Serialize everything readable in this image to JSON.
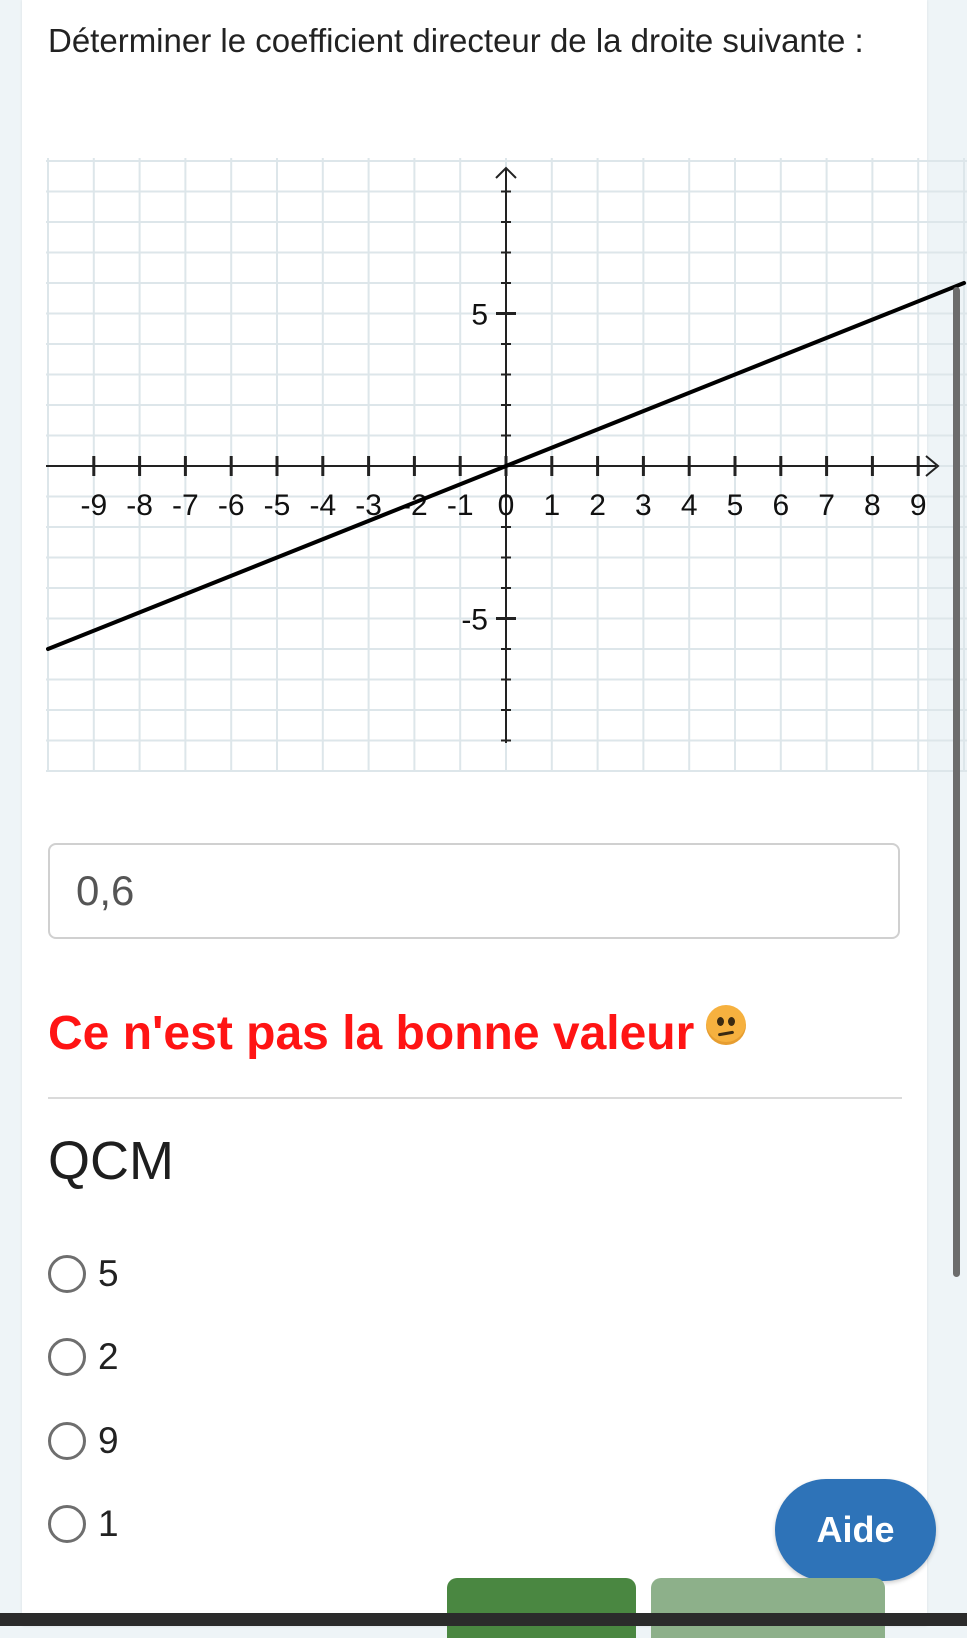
{
  "question": {
    "text": "Déterminer le coefficient directeur de la droite suivante :"
  },
  "chart_data": {
    "type": "line",
    "title": "",
    "xlabel": "",
    "ylabel": "",
    "xlim": [
      -10,
      10
    ],
    "ylim": [
      -10,
      10
    ],
    "grid": true,
    "x_ticks": [
      -9,
      -8,
      -7,
      -6,
      -5,
      -4,
      -3,
      -2,
      -1,
      0,
      1,
      2,
      3,
      4,
      5,
      6,
      7,
      8,
      9
    ],
    "y_tick_labels": [
      5,
      -5
    ],
    "series": [
      {
        "x": [
          -10,
          10
        ],
        "y": [
          -6,
          6
        ],
        "color": "#000000"
      }
    ]
  },
  "answer": {
    "value": "0,6"
  },
  "feedback": {
    "text": "Ce n'est pas la bonne valeur",
    "emoji": "confused-face-icon",
    "color": "#ff1414"
  },
  "qcm": {
    "title": "QCM",
    "options": [
      {
        "label": "5"
      },
      {
        "label": "2"
      },
      {
        "label": "9"
      },
      {
        "label": "1"
      }
    ]
  },
  "buttons": {
    "aide": "Aide",
    "aide_color": "#2e73b8",
    "valider_color": "#4a8741",
    "suivant_color": "#8db08a"
  }
}
